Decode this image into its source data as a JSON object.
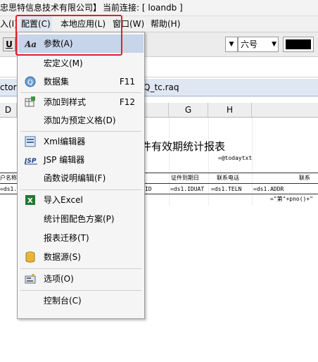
{
  "title_bar": {
    "company": "忠思特信息技术有限公司】",
    "connection": "当前连接: [ loandb ]"
  },
  "menubar": {
    "items": [
      {
        "label": "入(I)"
      },
      {
        "label": "配置(C)"
      },
      {
        "label": "本地应用(L)"
      },
      {
        "label": "窗口(W)"
      },
      {
        "label": "帮助(H)"
      }
    ]
  },
  "toolbar": {
    "underline_label": "U",
    "font_size": "六号",
    "text_color": "#000000"
  },
  "doc_tabs": {
    "left_tab": "ctory",
    "right_tab": "Q_tc.raq"
  },
  "sheet": {
    "columns": [
      "D",
      "G",
      "H"
    ],
    "report_title": "件有效期统计报表",
    "today_cell": "=@todaytxt",
    "header_cells": [
      "户名称",
      "证件到期日",
      "联系电话",
      "联系"
    ],
    "data_cells": [
      "=ds1.CU",
      "ID",
      "=ds1.IDUAT",
      "=ds1.TELN",
      "=ds1.ADDR"
    ],
    "page_cell": "=\"第\"+pno()+\""
  },
  "dropdown_menu": {
    "items": [
      {
        "label": "参数(A)",
        "shortcut": "",
        "icon": "aa-font-icon"
      },
      {
        "label": "宏定义(M)",
        "shortcut": "",
        "icon": ""
      },
      {
        "label": "数据集",
        "shortcut": "F11",
        "icon": "dataset-icon"
      },
      {
        "label": "添加到样式",
        "shortcut": "F12",
        "icon": "add-style-icon"
      },
      {
        "label": "添加为预定义格(D)",
        "shortcut": "",
        "icon": ""
      },
      {
        "label": "Xml编辑器",
        "shortcut": "",
        "icon": "xml-editor-icon"
      },
      {
        "label": "JSP 编辑器",
        "shortcut": "",
        "icon": "jsp-icon"
      },
      {
        "label": "函数说明编辑(F)",
        "shortcut": "",
        "icon": ""
      },
      {
        "label": "导入Excel",
        "shortcut": "",
        "icon": "excel-icon"
      },
      {
        "label": "统计图配色方案(P)",
        "shortcut": "",
        "icon": ""
      },
      {
        "label": "报表迁移(T)",
        "shortcut": "",
        "icon": ""
      },
      {
        "label": "数据源(S)",
        "shortcut": "",
        "icon": "datasource-icon"
      },
      {
        "label": "选项(O)",
        "shortcut": "",
        "icon": "options-icon"
      },
      {
        "label": "控制台(C)",
        "shortcut": "",
        "icon": ""
      }
    ],
    "highlight_color": "#e41f26"
  }
}
